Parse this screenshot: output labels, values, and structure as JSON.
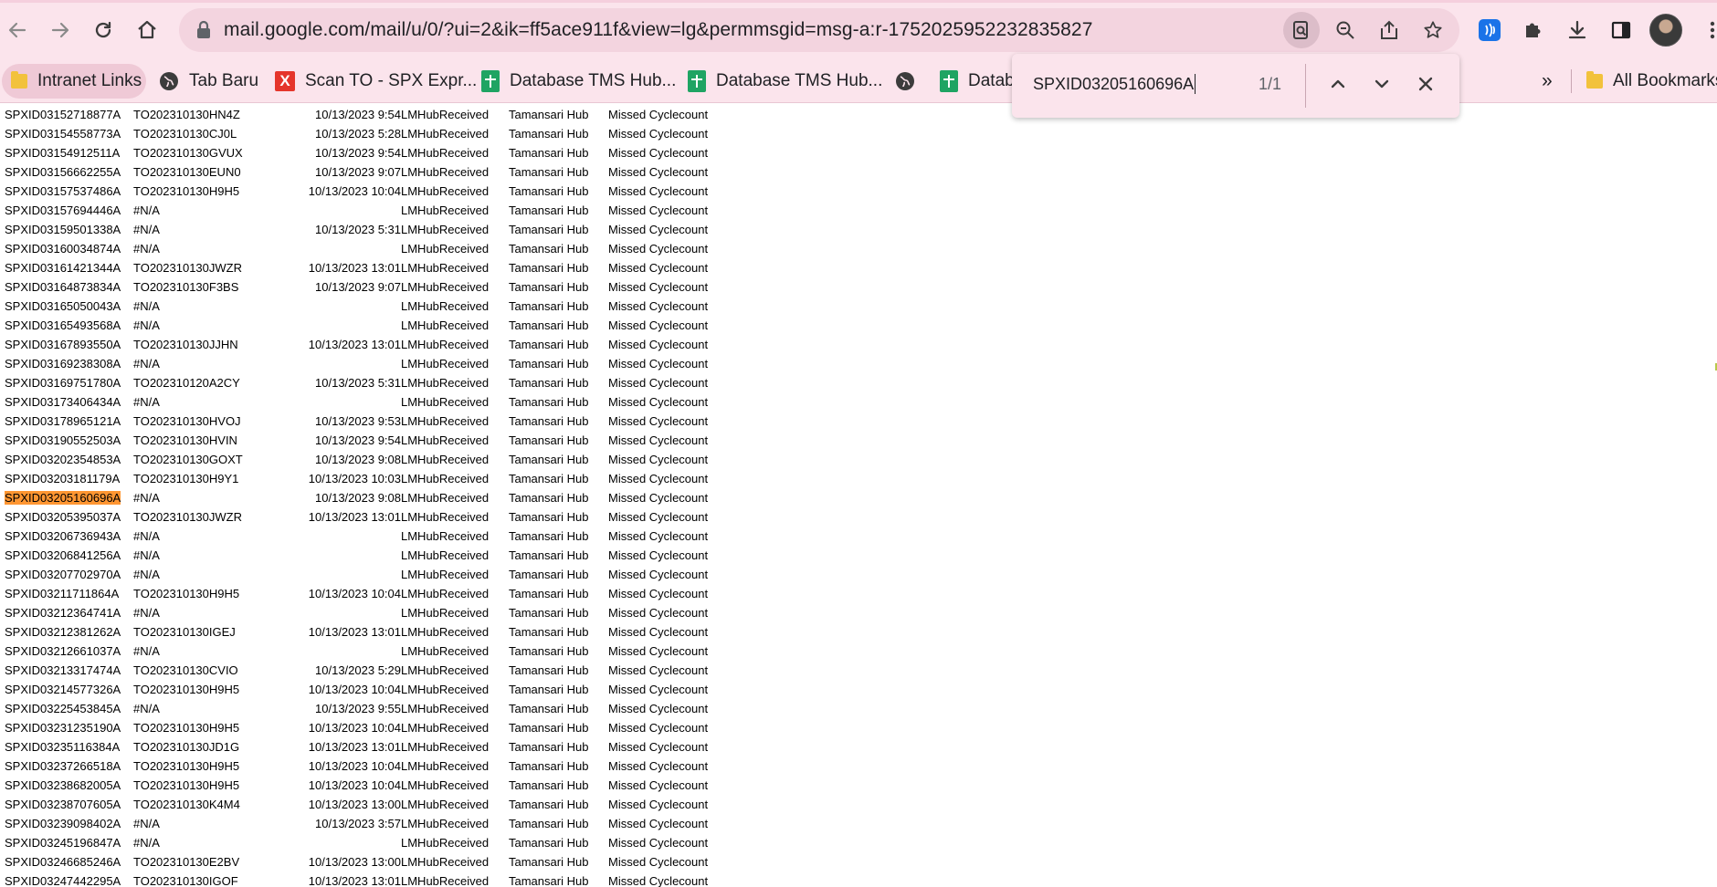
{
  "browser": {
    "url": "mail.google.com/mail/u/0/?ui=2&ik=ff5ace911f&view=lg&permmsgid=msg-a:r-1752025952232835827",
    "nav": {
      "back_icon": "arrow-left-icon",
      "forward_icon": "arrow-right-icon",
      "reload_icon": "reload-icon",
      "home_icon": "home-icon"
    },
    "omnibox_icons": [
      "find-in-page-icon",
      "zoom-out-icon",
      "share-icon",
      "star-icon"
    ],
    "extension_icons": [
      "nfc-extension-icon",
      "puzzle-icon",
      "download-icon",
      "side-panel-icon"
    ]
  },
  "bookmarks": {
    "items": [
      {
        "label": "Intranet Links",
        "icon": "folder-icon"
      },
      {
        "label": "Tab Baru",
        "icon": "globe-icon"
      },
      {
        "label": "Scan TO - SPX Expr...",
        "icon": "x-logo-icon"
      },
      {
        "label": "Database TMS Hub...",
        "icon": "sheets-icon"
      },
      {
        "label": "Database TMS Hub...",
        "icon": "sheets-icon"
      },
      {
        "label": "",
        "icon": "globe-icon"
      },
      {
        "label": "Datab",
        "icon": "sheets-icon"
      }
    ],
    "overflow_label": "»",
    "all_bookmarks_label": "All Bookmarks"
  },
  "find": {
    "query": "SPXID03205160696A",
    "count": "1/1",
    "prev_icon": "chevron-up-icon",
    "next_icon": "chevron-down-icon",
    "close_icon": "close-icon"
  },
  "highlight_color": "#ff9632",
  "rows": [
    [
      "SPXID03152718877A",
      "TO202310130HN4Z",
      "10/13/2023 9:54",
      "LMHubReceived",
      "Tamansari Hub",
      "Missed Cyclecount"
    ],
    [
      "SPXID03154558773A",
      "TO202310130CJ0L",
      "10/13/2023 5:28",
      "LMHubReceived",
      "Tamansari Hub",
      "Missed Cyclecount"
    ],
    [
      "SPXID03154912511A",
      "TO202310130GVUX",
      "10/13/2023 9:54",
      "LMHubReceived",
      "Tamansari Hub",
      "Missed Cyclecount"
    ],
    [
      "SPXID03156662255A",
      "TO202310130EUN0",
      "10/13/2023 9:07",
      "LMHubReceived",
      "Tamansari Hub",
      "Missed Cyclecount"
    ],
    [
      "SPXID03157537486A",
      "TO202310130H9H5",
      "10/13/2023 10:04",
      "LMHubReceived",
      "Tamansari Hub",
      "Missed Cyclecount"
    ],
    [
      "SPXID03157694446A",
      "#N/A",
      "",
      "LMHubReceived",
      "Tamansari Hub",
      "Missed Cyclecount"
    ],
    [
      "SPXID03159501338A",
      "#N/A",
      "10/13/2023 5:31",
      "LMHubReceived",
      "Tamansari Hub",
      "Missed Cyclecount"
    ],
    [
      "SPXID03160034874A",
      "#N/A",
      "",
      "LMHubReceived",
      "Tamansari Hub",
      "Missed Cyclecount"
    ],
    [
      "SPXID03161421344A",
      "TO202310130JWZR",
      "10/13/2023 13:01",
      "LMHubReceived",
      "Tamansari Hub",
      "Missed Cyclecount"
    ],
    [
      "SPXID03164873834A",
      "TO202310130F3BS",
      "10/13/2023 9:07",
      "LMHubReceived",
      "Tamansari Hub",
      "Missed Cyclecount"
    ],
    [
      "SPXID03165050043A",
      "#N/A",
      "",
      "LMHubReceived",
      "Tamansari Hub",
      "Missed Cyclecount"
    ],
    [
      "SPXID03165493568A",
      "#N/A",
      "",
      "LMHubReceived",
      "Tamansari Hub",
      "Missed Cyclecount"
    ],
    [
      "SPXID03167893550A",
      "TO202310130JJHN",
      "10/13/2023 13:01",
      "LMHubReceived",
      "Tamansari Hub",
      "Missed Cyclecount"
    ],
    [
      "SPXID03169238308A",
      "#N/A",
      "",
      "LMHubReceived",
      "Tamansari Hub",
      "Missed Cyclecount"
    ],
    [
      "SPXID03169751780A",
      "TO202310120A2CY",
      "10/13/2023 5:31",
      "LMHubReceived",
      "Tamansari Hub",
      "Missed Cyclecount"
    ],
    [
      "SPXID03173406434A",
      "#N/A",
      "",
      "LMHubReceived",
      "Tamansari Hub",
      "Missed Cyclecount"
    ],
    [
      "SPXID03178965121A",
      "TO202310130HVOJ",
      "10/13/2023 9:53",
      "LMHubReceived",
      "Tamansari Hub",
      "Missed Cyclecount"
    ],
    [
      "SPXID03190552503A",
      "TO202310130HVIN",
      "10/13/2023 9:54",
      "LMHubReceived",
      "Tamansari Hub",
      "Missed Cyclecount"
    ],
    [
      "SPXID03202354853A",
      "TO202310130GOXT",
      "10/13/2023 9:08",
      "LMHubReceived",
      "Tamansari Hub",
      "Missed Cyclecount"
    ],
    [
      "SPXID03203181179A",
      "TO202310130H9Y1",
      "10/13/2023 10:03",
      "LMHubReceived",
      "Tamansari Hub",
      "Missed Cyclecount"
    ],
    [
      "SPXID03205160696A",
      "#N/A",
      "10/13/2023 9:08",
      "LMHubReceived",
      "Tamansari Hub",
      "Missed Cyclecount"
    ],
    [
      "SPXID03205395037A",
      "TO202310130JWZR",
      "10/13/2023 13:01",
      "LMHubReceived",
      "Tamansari Hub",
      "Missed Cyclecount"
    ],
    [
      "SPXID03206736943A",
      "#N/A",
      "",
      "LMHubReceived",
      "Tamansari Hub",
      "Missed Cyclecount"
    ],
    [
      "SPXID03206841256A",
      "#N/A",
      "",
      "LMHubReceived",
      "Tamansari Hub",
      "Missed Cyclecount"
    ],
    [
      "SPXID03207702970A",
      "#N/A",
      "",
      "LMHubReceived",
      "Tamansari Hub",
      "Missed Cyclecount"
    ],
    [
      "SPXID03211711864A",
      "TO202310130H9H5",
      "10/13/2023 10:04",
      "LMHubReceived",
      "Tamansari Hub",
      "Missed Cyclecount"
    ],
    [
      "SPXID03212364741A",
      "#N/A",
      "",
      "LMHubReceived",
      "Tamansari Hub",
      "Missed Cyclecount"
    ],
    [
      "SPXID03212381262A",
      "TO202310130IGEJ",
      "10/13/2023 13:01",
      "LMHubReceived",
      "Tamansari Hub",
      "Missed Cyclecount"
    ],
    [
      "SPXID03212661037A",
      "#N/A",
      "",
      "LMHubReceived",
      "Tamansari Hub",
      "Missed Cyclecount"
    ],
    [
      "SPXID03213317474A",
      "TO202310130CVIO",
      "10/13/2023 5:29",
      "LMHubReceived",
      "Tamansari Hub",
      "Missed Cyclecount"
    ],
    [
      "SPXID03214577326A",
      "TO202310130H9H5",
      "10/13/2023 10:04",
      "LMHubReceived",
      "Tamansari Hub",
      "Missed Cyclecount"
    ],
    [
      "SPXID03225453845A",
      "#N/A",
      "10/13/2023 9:55",
      "LMHubReceived",
      "Tamansari Hub",
      "Missed Cyclecount"
    ],
    [
      "SPXID03231235190A",
      "TO202310130H9H5",
      "10/13/2023 10:04",
      "LMHubReceived",
      "Tamansari Hub",
      "Missed Cyclecount"
    ],
    [
      "SPXID03235116384A",
      "TO202310130JD1G",
      "10/13/2023 13:01",
      "LMHubReceived",
      "Tamansari Hub",
      "Missed Cyclecount"
    ],
    [
      "SPXID03237266518A",
      "TO202310130H9H5",
      "10/13/2023 10:04",
      "LMHubReceived",
      "Tamansari Hub",
      "Missed Cyclecount"
    ],
    [
      "SPXID03238682005A",
      "TO202310130H9H5",
      "10/13/2023 10:04",
      "LMHubReceived",
      "Tamansari Hub",
      "Missed Cyclecount"
    ],
    [
      "SPXID03238707605A",
      "TO202310130K4M4",
      "10/13/2023 13:00",
      "LMHubReceived",
      "Tamansari Hub",
      "Missed Cyclecount"
    ],
    [
      "SPXID03239098402A",
      "#N/A",
      "10/13/2023 3:57",
      "LMHubReceived",
      "Tamansari Hub",
      "Missed Cyclecount"
    ],
    [
      "SPXID03245196847A",
      "#N/A",
      "",
      "LMHubReceived",
      "Tamansari Hub",
      "Missed Cyclecount"
    ],
    [
      "SPXID03246685246A",
      "TO202310130E2BV",
      "10/13/2023 13:00",
      "LMHubReceived",
      "Tamansari Hub",
      "Missed Cyclecount"
    ],
    [
      "SPXID03247442295A",
      "TO202310130IGOF",
      "10/13/2023 13:01",
      "LMHubReceived",
      "Tamansari Hub",
      "Missed Cyclecount"
    ]
  ]
}
